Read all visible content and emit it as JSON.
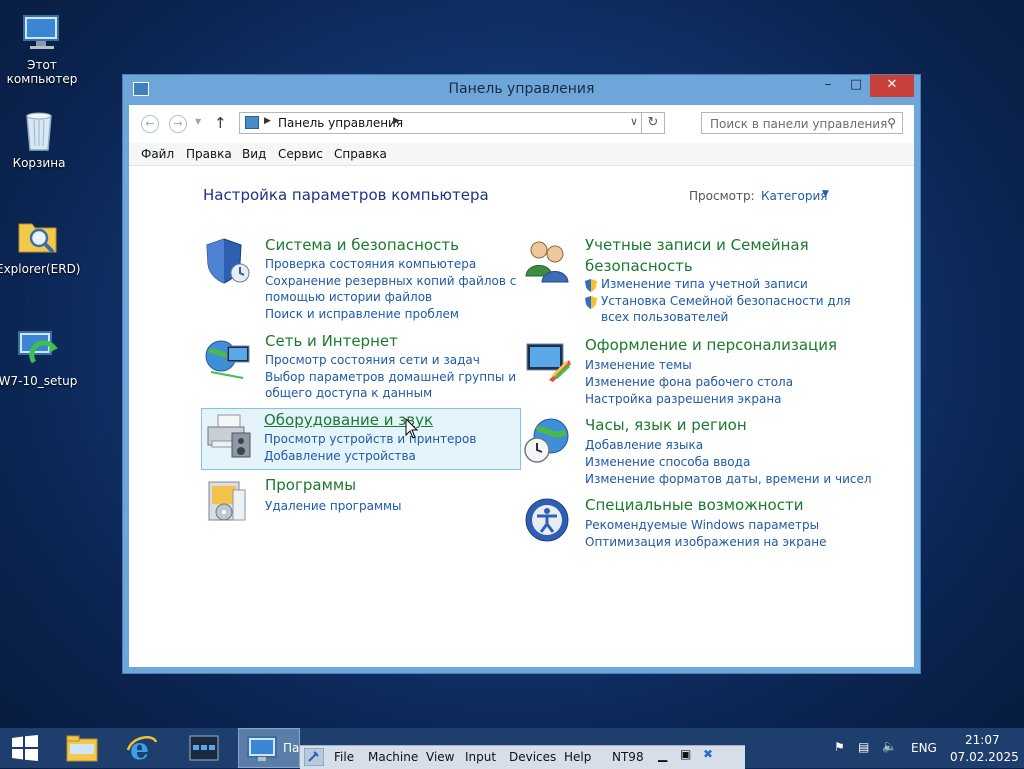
{
  "desktop": {
    "icons": [
      {
        "label": "Этот компьютер"
      },
      {
        "label": "Корзина"
      },
      {
        "label": "Explorer(ERD)"
      },
      {
        "label": "W7-10_setup"
      }
    ]
  },
  "window": {
    "title": "Панель управления",
    "breadcrumb": "Панель управления",
    "search_placeholder": "Поиск в панели управления",
    "menu": [
      "Файл",
      "Правка",
      "Вид",
      "Сервис",
      "Справка"
    ]
  },
  "content": {
    "heading": "Настройка параметров компьютера",
    "view_label": "Просмотр:",
    "view_value": "Категория",
    "categories": [
      {
        "title": "Система и безопасность",
        "links": [
          "Проверка состояния компьютера",
          "Сохранение резервных копий файлов с",
          "помощью истории файлов",
          "Поиск и исправление проблем"
        ]
      },
      {
        "title": "Сеть и Интернет",
        "links": [
          "Просмотр состояния сети и задач",
          "Выбор параметров домашней группы и",
          "общего доступа к данным"
        ]
      },
      {
        "title": "Оборудование и звук",
        "links": [
          "Просмотр устройств и принтеров",
          "Добавление устройства"
        ]
      },
      {
        "title": "Программы",
        "links": [
          "Удаление программы"
        ]
      },
      {
        "title": "Учетные записи и Семейная",
        "title2": "безопасность",
        "links": [
          "Изменение типа учетной записи",
          "Установка Семейной безопасности для",
          "всех пользователей"
        ]
      },
      {
        "title": "Оформление и персонализация",
        "links": [
          "Изменение темы",
          "Изменение фона рабочего стола",
          "Настройка разрешения экрана"
        ]
      },
      {
        "title": "Часы, язык и регион",
        "links": [
          "Добавление языка",
          "Изменение способа ввода",
          "Изменение форматов даты, времени и чисел"
        ]
      },
      {
        "title": "Специальные возможности",
        "links": [
          "Рекомендуемые Windows параметры",
          "Оптимизация изображения на экране"
        ]
      }
    ]
  },
  "taskbar": {
    "active_task_label": "Па",
    "language": "ENG",
    "time": "21:07",
    "date": "07.02.2025"
  },
  "vm_toolbar": {
    "items": [
      "File",
      "Machine",
      "View",
      "Input",
      "Devices",
      "Help",
      "NT98"
    ]
  },
  "colors": {
    "heading_green": "#1a7a2f",
    "link_blue": "#1e5aa8",
    "close_red": "#c7413a",
    "taskbar": "#1e3f6d"
  }
}
